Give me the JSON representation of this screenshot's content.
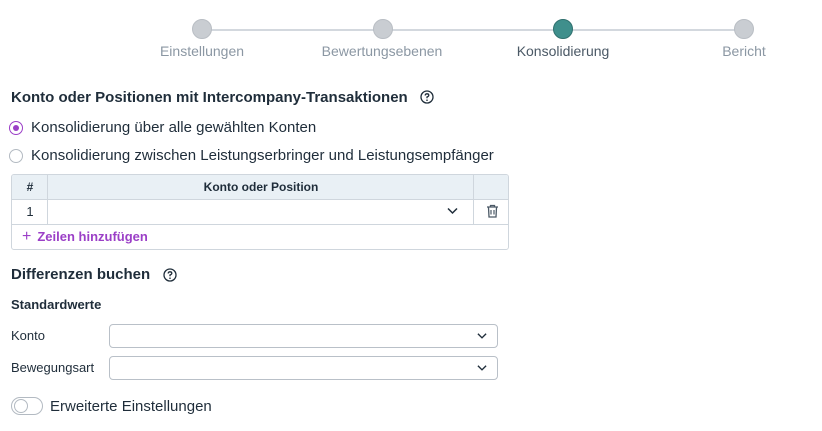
{
  "stepper": {
    "steps": [
      {
        "label": "Einstellungen",
        "state": "inactive"
      },
      {
        "label": "Bewertungsebenen",
        "state": "inactive"
      },
      {
        "label": "Konsolidierung",
        "state": "active"
      },
      {
        "label": "Bericht",
        "state": "inactive"
      }
    ]
  },
  "ic_section": {
    "title": "Konto oder Positionen mit Intercompany-Transaktionen",
    "options": [
      {
        "label": "Konsolidierung über alle gewählten Konten",
        "checked": true
      },
      {
        "label": "Konsolidierung zwischen Leistungserbringer und Leistungsempfänger",
        "checked": false
      }
    ],
    "table": {
      "headers": [
        "#",
        "Konto oder Position"
      ],
      "rows": [
        {
          "num": "1",
          "value": ""
        }
      ],
      "add_label": "Zeilen hinzufügen"
    }
  },
  "diff_section": {
    "title": "Differenzen buchen",
    "subtitle": "Standardwerte",
    "fields": [
      {
        "label": "Konto",
        "value": ""
      },
      {
        "label": "Bewegungsart",
        "value": ""
      }
    ]
  },
  "advanced": {
    "label": "Erweiterte Einstellungen",
    "enabled": false
  },
  "colors": {
    "accent": "#9b3fc7",
    "step_active": "#3f8f8c",
    "step_inactive": "#c9cdd2"
  }
}
